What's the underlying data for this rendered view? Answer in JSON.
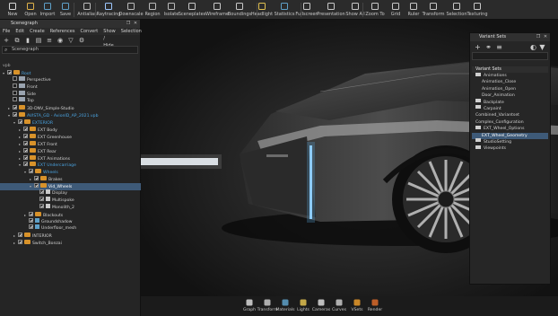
{
  "toolbar": {
    "items": [
      {
        "label": "New",
        "icon": "new-file-icon"
      },
      {
        "label": "Open",
        "icon": "open-folder-icon"
      },
      {
        "label": "Import",
        "icon": "import-icon"
      },
      {
        "label": "Save",
        "icon": "save-icon"
      },
      {
        "label": "Antialias",
        "icon": "antialias-icon"
      },
      {
        "label": "Raytracing",
        "icon": "raytracing-icon"
      },
      {
        "label": "Downscale",
        "icon": "downscale-icon"
      },
      {
        "label": "Region",
        "icon": "region-icon"
      },
      {
        "label": "Isolate",
        "icon": "isolate-icon"
      },
      {
        "label": "Sceneplates",
        "icon": "sceneplates-icon"
      },
      {
        "label": "Wireframe",
        "icon": "wireframe-icon"
      },
      {
        "label": "Boundings",
        "icon": "boundings-icon"
      },
      {
        "label": "Headlight",
        "icon": "headlight-icon"
      },
      {
        "label": "Statistics",
        "icon": "statistics-icon"
      },
      {
        "label": "Fullscreen",
        "icon": "fullscreen-icon"
      },
      {
        "label": "Presentation",
        "icon": "presentation-icon"
      },
      {
        "label": "Show All",
        "icon": "show-all-icon"
      },
      {
        "label": "Zoom To",
        "icon": "zoom-to-icon"
      },
      {
        "label": "Grid",
        "icon": "grid-icon"
      },
      {
        "label": "Ruler",
        "icon": "ruler-icon"
      },
      {
        "label": "Transform",
        "icon": "transform-icon"
      },
      {
        "label": "Selection",
        "icon": "selection-icon"
      },
      {
        "label": "Texturing",
        "icon": "texturing-icon"
      }
    ]
  },
  "scenegraph": {
    "title": "Scenegraph",
    "menu": [
      "File",
      "Edit",
      "Create",
      "References",
      "Convert",
      "Show / Hide",
      "Selection"
    ],
    "search_label": "Scenegraph",
    "root_header": "vpb",
    "tree": [
      {
        "label": "Root",
        "depth": 0,
        "arrow": "▾",
        "icon": "folder",
        "checked": true,
        "selected": false,
        "highlight": true
      },
      {
        "label": "Perspective",
        "depth": 1,
        "arrow": "",
        "icon": "cam",
        "checked": false,
        "selected": false,
        "highlight": false
      },
      {
        "label": "Front",
        "depth": 1,
        "arrow": "",
        "icon": "cam",
        "checked": false,
        "selected": false,
        "highlight": false
      },
      {
        "label": "Side",
        "depth": 1,
        "arrow": "",
        "icon": "cam",
        "checked": false,
        "selected": false,
        "highlight": false
      },
      {
        "label": "Top",
        "depth": 1,
        "arrow": "",
        "icon": "cam",
        "checked": false,
        "selected": false,
        "highlight": false
      },
      {
        "label": "3D-DNV_Simple-Studio",
        "depth": 1,
        "arrow": "▸",
        "icon": "folder",
        "checked": true,
        "selected": false,
        "highlight": false
      },
      {
        "label": "AVISTA_GD - AvionID_AP_2021.vpb",
        "depth": 1,
        "arrow": "▾",
        "icon": "folder",
        "checked": true,
        "selected": false,
        "highlight": true
      },
      {
        "label": "EXTERIOR",
        "depth": 2,
        "arrow": "▾",
        "icon": "folder",
        "checked": true,
        "selected": false,
        "highlight": true
      },
      {
        "label": "EXT Body",
        "depth": 3,
        "arrow": "▸",
        "icon": "folder",
        "checked": true,
        "selected": false,
        "highlight": false
      },
      {
        "label": "EXT Greenhouse",
        "depth": 3,
        "arrow": "▸",
        "icon": "folder",
        "checked": true,
        "selected": false,
        "highlight": false
      },
      {
        "label": "EXT Front",
        "depth": 3,
        "arrow": "▸",
        "icon": "folder",
        "checked": true,
        "selected": false,
        "highlight": false
      },
      {
        "label": "EXT Rear",
        "depth": 3,
        "arrow": "▸",
        "icon": "folder",
        "checked": true,
        "selected": false,
        "highlight": false
      },
      {
        "label": "EXT Animations",
        "depth": 3,
        "arrow": "▸",
        "icon": "folder",
        "checked": true,
        "selected": false,
        "highlight": false
      },
      {
        "label": "EXT Undercarriage",
        "depth": 3,
        "arrow": "▾",
        "icon": "folder",
        "checked": true,
        "selected": false,
        "highlight": true
      },
      {
        "label": "Wheels",
        "depth": 4,
        "arrow": "▾",
        "icon": "folder",
        "checked": true,
        "selected": false,
        "highlight": true
      },
      {
        "label": "Brakes",
        "depth": 5,
        "arrow": "▸",
        "icon": "folder",
        "checked": true,
        "selected": false,
        "highlight": false
      },
      {
        "label": "Vid_Wheels",
        "depth": 5,
        "arrow": "▾",
        "icon": "folder",
        "checked": true,
        "selected": true,
        "highlight": false
      },
      {
        "label": "Display",
        "depth": 6,
        "arrow": "",
        "icon": "node",
        "checked": true,
        "selected": false,
        "highlight": false
      },
      {
        "label": "Multispoke",
        "depth": 6,
        "arrow": "",
        "icon": "node",
        "checked": true,
        "selected": false,
        "highlight": false
      },
      {
        "label": "Monolith_2",
        "depth": 6,
        "arrow": "",
        "icon": "node",
        "checked": true,
        "selected": false,
        "highlight": false
      },
      {
        "label": "Blackouts",
        "depth": 4,
        "arrow": "▸",
        "icon": "folder",
        "checked": true,
        "selected": false,
        "highlight": false
      },
      {
        "label": "Groundshadow",
        "depth": 4,
        "arrow": "",
        "icon": "mesh",
        "checked": true,
        "selected": false,
        "highlight": false
      },
      {
        "label": "Underfloor_mesh",
        "depth": 4,
        "arrow": "",
        "icon": "mesh",
        "checked": true,
        "selected": false,
        "highlight": false
      },
      {
        "label": "INTERIOR",
        "depth": 2,
        "arrow": "▸",
        "icon": "folder",
        "checked": true,
        "selected": false,
        "highlight": false
      },
      {
        "label": "Switch_Bonzai",
        "depth": 2,
        "arrow": "▸",
        "icon": "folder",
        "checked": true,
        "selected": false,
        "highlight": false
      }
    ]
  },
  "variant_sets": {
    "title": "Variant Sets",
    "header": "Variant Sets",
    "rows": [
      {
        "label": "Animations",
        "indent": 0,
        "folder": true,
        "selected": false
      },
      {
        "label": "Animation_Close",
        "indent": 1,
        "folder": false,
        "selected": false
      },
      {
        "label": "Animation_Open",
        "indent": 1,
        "folder": false,
        "selected": false
      },
      {
        "label": "Door_Animation",
        "indent": 1,
        "folder": false,
        "selected": false
      },
      {
        "label": "Backplate",
        "indent": 0,
        "folder": true,
        "selected": false
      },
      {
        "label": "Carpaint",
        "indent": 0,
        "folder": true,
        "selected": false
      },
      {
        "label": "Combined_Variantset",
        "indent": 0,
        "folder": false,
        "selected": false
      },
      {
        "label": "Complex_Configuration",
        "indent": 0,
        "folder": false,
        "selected": false
      },
      {
        "label": "EXT_Wheel_Options",
        "indent": 0,
        "folder": true,
        "selected": false
      },
      {
        "label": "EXT_Wheel_Geometry",
        "indent": 1,
        "folder": false,
        "selected": true
      },
      {
        "label": "StudioSetting",
        "indent": 0,
        "folder": true,
        "selected": false
      },
      {
        "label": "Viewpoints",
        "indent": 0,
        "folder": true,
        "selected": false
      }
    ]
  },
  "dock": {
    "items": [
      {
        "label": "Graph",
        "icon": "graph-icon"
      },
      {
        "label": "Transform",
        "icon": "transform-icon"
      },
      {
        "label": "Materials",
        "icon": "materials-icon"
      },
      {
        "label": "Lights",
        "icon": "lights-icon"
      },
      {
        "label": "Cameras",
        "icon": "cameras-icon"
      },
      {
        "label": "Curves",
        "icon": "curves-icon"
      },
      {
        "label": "VSets",
        "icon": "vsets-icon"
      },
      {
        "label": "Render",
        "icon": "render-icon"
      }
    ]
  },
  "colors": {
    "accent": "#3e5a78",
    "tree_highlight": "#4aa3e0",
    "folder": "#d8922a"
  }
}
